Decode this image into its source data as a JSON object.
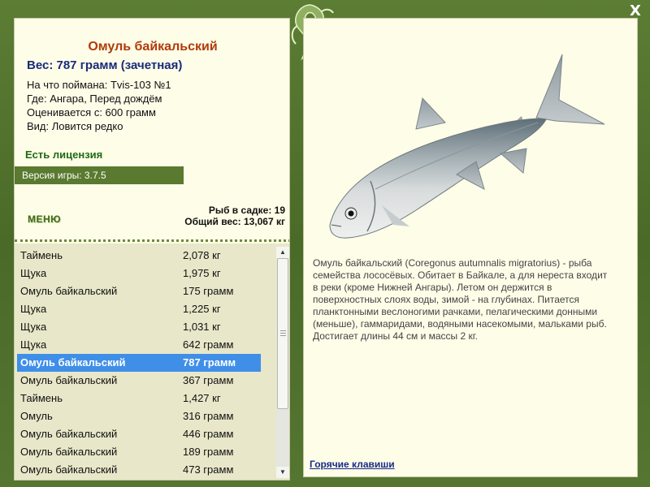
{
  "fish": {
    "title": "Омуль байкальский",
    "weight_line": "Вес: 787 грамм (зачетная)",
    "info": [
      "На что поймана: Tvis-103 №1",
      "Где: Ангара, Перед дождём",
      "Оценивается с: 600 грамм",
      "Вид: Ловится редко"
    ],
    "license": "Есть лицензия",
    "version": "Версия игры: 3.7.5"
  },
  "menu_label": "МЕНЮ",
  "stats": {
    "count": "Рыб в садке: 19",
    "total": "Общий вес: 13,067 кг"
  },
  "catch_list": [
    {
      "name": "Таймень",
      "weight": "2,078 кг"
    },
    {
      "name": "Щука",
      "weight": "1,975 кг"
    },
    {
      "name": "Омуль байкальский",
      "weight": "175 грамм"
    },
    {
      "name": "Щука",
      "weight": "1,225 кг"
    },
    {
      "name": "Щука",
      "weight": "1,031 кг"
    },
    {
      "name": "Щука",
      "weight": "642 грамм"
    },
    {
      "name": "Омуль байкальский",
      "weight": "787 грамм",
      "selected": true
    },
    {
      "name": "Омуль байкальский",
      "weight": "367 грамм"
    },
    {
      "name": "Таймень",
      "weight": "1,427 кг"
    },
    {
      "name": "Омуль",
      "weight": "316 грамм"
    },
    {
      "name": "Омуль байкальский",
      "weight": "446 грамм"
    },
    {
      "name": "Омуль байкальский",
      "weight": "189 грамм"
    },
    {
      "name": "Омуль байкальский",
      "weight": "473 грамм"
    }
  ],
  "description": "Омуль байкальский (Coregonus autumnalis migratorius) - рыба семейства лососёвых. Обитает в Байкале, а для нереста входит в реки (кроме Нижней Ангары). Летом он держится в поверхностных слоях воды, зимой - на глубинах. Питается планктонными веслоногими рачками, пелагическими донными (меньше), гаммаридами, водяными насекомыми, мальками рыб. Достигает длины 44 см и массы 2 кг.",
  "hotkeys_label": "Горячие клавиши",
  "close_label": "X",
  "icons": {
    "close": "close-icon",
    "logo": "fish-logo-icon",
    "scroll_up": "scroll-up-icon",
    "scroll_down": "scroll-down-icon"
  },
  "colors": {
    "frame": "#4f6f2c",
    "panel": "#fdfde8",
    "list_bg": "#e8e7c9",
    "selected": "#3f8fe8",
    "title": "#b23a0a"
  }
}
